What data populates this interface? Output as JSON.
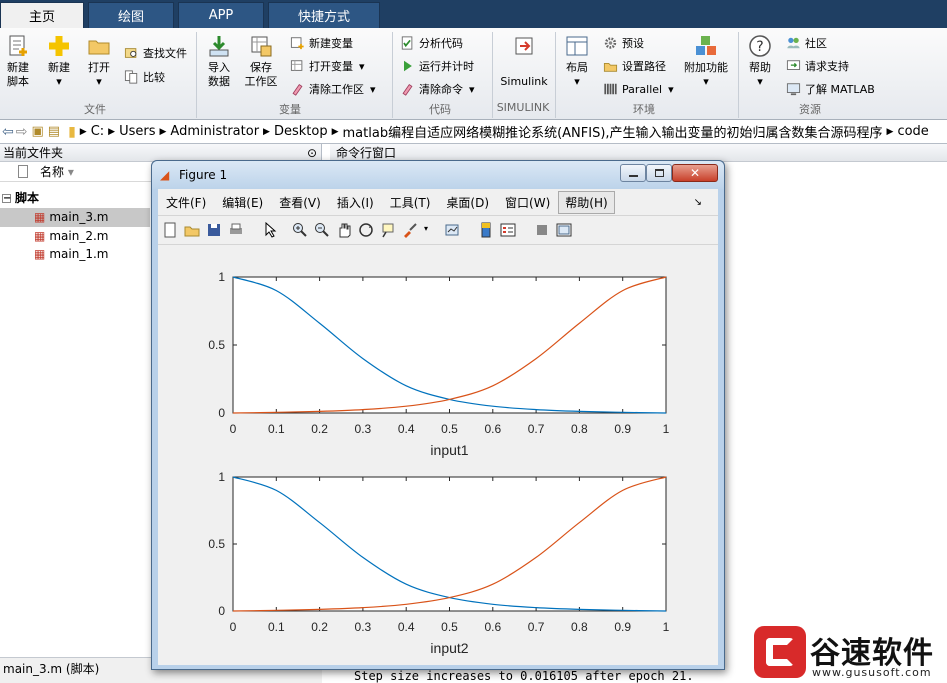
{
  "tabs": [
    "主页",
    "绘图",
    "APP",
    "快捷方式"
  ],
  "ribbon": {
    "new_script": [
      "新建",
      "脚本"
    ],
    "new": "新建",
    "open": "打开",
    "find_files": "查找文件",
    "compare": "比较",
    "import_data": [
      "导入",
      "数据"
    ],
    "save_workspace": [
      "保存",
      "工作区"
    ],
    "new_variable": "新建变量",
    "open_variable": "打开变量",
    "clear_workspace": "清除工作区",
    "analyze_code": "分析代码",
    "run_and_time": "运行并计时",
    "clear_commands": "清除命令",
    "simulink": "Simulink",
    "layout": "布局",
    "preferences": "预设",
    "set_path": "设置路径",
    "parallel": "Parallel",
    "addons": "附加功能",
    "help": "帮助",
    "community": "社区",
    "request_support": "请求支持",
    "learn_matlab": "了解 MATLAB",
    "groups": [
      "文件",
      "变量",
      "代码",
      "SIMULINK",
      "环境",
      "资源"
    ]
  },
  "address": [
    "C:",
    "Users",
    "Administrator",
    "Desktop",
    "matlab编程自适应网络模糊推论系统(ANFIS),产生输入输出变量的初始归属含数集合源码程序",
    "code"
  ],
  "current_folder": {
    "title": "当前文件夹",
    "col_name": "名称",
    "group": "脚本",
    "files": [
      "main_3.m",
      "main_2.m",
      "main_1.m"
    ],
    "status": "main_3.m  (脚本)"
  },
  "command_window": {
    "title": "命令行窗口",
    "last_line": "Step size increases to 0.016105 after epoch 21."
  },
  "figure": {
    "title": "Figure 1",
    "menu": [
      "文件(F)",
      "编辑(E)",
      "查看(V)",
      "插入(I)",
      "工具(T)",
      "桌面(D)",
      "窗口(W)",
      "帮助(H)"
    ]
  },
  "colors": {
    "blue_series": "#0072bd",
    "orange_series": "#d95319",
    "tabbar": "#1f3f63"
  },
  "chart_data": [
    {
      "type": "line",
      "xlabel": "input1",
      "xlim": [
        0,
        1
      ],
      "ylim": [
        0,
        1
      ],
      "xticks": [
        "0",
        "0.1",
        "0.2",
        "0.3",
        "0.4",
        "0.5",
        "0.6",
        "0.7",
        "0.8",
        "0.9",
        "1"
      ],
      "yticks": [
        "0",
        "0.5",
        "1"
      ],
      "x": [
        0,
        0.1,
        0.2,
        0.3,
        0.4,
        0.5,
        0.6,
        0.7,
        0.8,
        0.9,
        1
      ],
      "series": [
        {
          "values": [
            1,
            0.9,
            0.66,
            0.4,
            0.2,
            0.1,
            0.05,
            0.025,
            0.012,
            0.005,
            0
          ]
        },
        {
          "values": [
            0,
            0.005,
            0.012,
            0.025,
            0.05,
            0.1,
            0.2,
            0.4,
            0.66,
            0.9,
            1
          ]
        }
      ]
    },
    {
      "type": "line",
      "xlabel": "input2",
      "xlim": [
        0,
        1
      ],
      "ylim": [
        0,
        1
      ],
      "xticks": [
        "0",
        "0.1",
        "0.2",
        "0.3",
        "0.4",
        "0.5",
        "0.6",
        "0.7",
        "0.8",
        "0.9",
        "1"
      ],
      "yticks": [
        "0",
        "0.5",
        "1"
      ],
      "x": [
        0,
        0.1,
        0.2,
        0.3,
        0.4,
        0.5,
        0.6,
        0.7,
        0.8,
        0.9,
        1
      ],
      "series": [
        {
          "values": [
            1,
            0.9,
            0.66,
            0.4,
            0.2,
            0.1,
            0.05,
            0.025,
            0.012,
            0.005,
            0
          ]
        },
        {
          "values": [
            0,
            0.005,
            0.012,
            0.025,
            0.05,
            0.1,
            0.2,
            0.4,
            0.66,
            0.9,
            1
          ]
        }
      ]
    }
  ],
  "watermark": {
    "brand": "谷速软件",
    "url": "www.gususoft.com"
  }
}
